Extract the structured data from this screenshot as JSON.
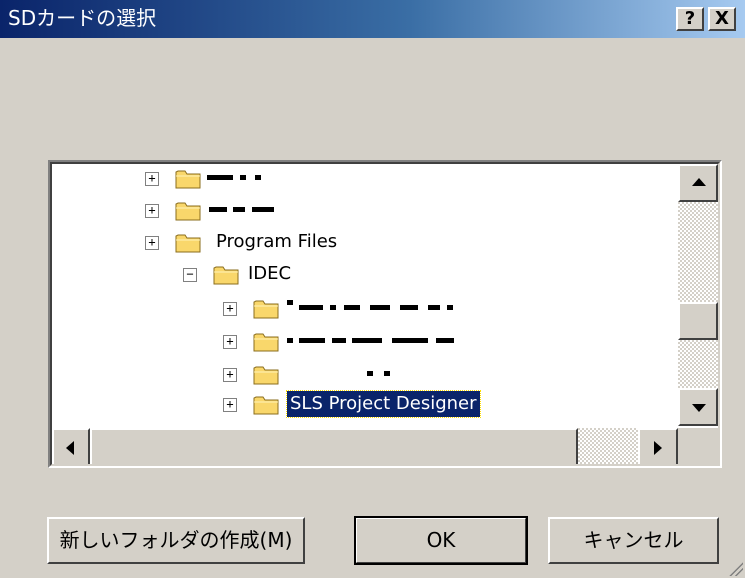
{
  "window": {
    "title": "SDカードの選択",
    "help_label": "?",
    "close_label": "X"
  },
  "tree": {
    "items": [
      {
        "label": "",
        "expander": "+"
      },
      {
        "label": "",
        "expander": "+"
      },
      {
        "label": "Program Files",
        "expander": "+"
      },
      {
        "label": "IDEC",
        "expander": "−"
      },
      {
        "label": "",
        "expander": "+"
      },
      {
        "label": "",
        "expander": "+"
      },
      {
        "label": "",
        "expander": "+"
      },
      {
        "label": "SLS Project Designer",
        "expander": "+",
        "selected": true
      },
      {
        "label": "",
        "expander": "+"
      }
    ]
  },
  "buttons": {
    "new_folder": "新しいフォルダの作成(M)",
    "ok": "OK",
    "cancel": "キャンセル"
  },
  "colors": {
    "title_active": "#0a246a",
    "selection": "#0a246a",
    "face": "#d4d0c8",
    "folder": "#f9d76b"
  }
}
